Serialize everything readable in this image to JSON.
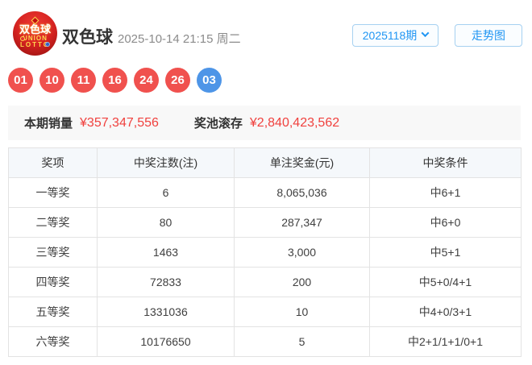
{
  "header": {
    "logo": {
      "line_cn": "双色球",
      "line_union": "UNION",
      "line_lotto": "LOTTO"
    },
    "title": "双色球",
    "datetime": "2025-10-14 21:15 周二",
    "period_selector": {
      "label": "2025118期"
    },
    "trend_button": "走势图"
  },
  "balls": {
    "red": [
      "01",
      "10",
      "11",
      "16",
      "24",
      "26"
    ],
    "blue": [
      "03"
    ]
  },
  "stats": {
    "sales_label": "本期销量",
    "sales_value": "¥357,347,556",
    "pool_label": "奖池滚存",
    "pool_value": "¥2,840,423,562"
  },
  "prize_table": {
    "headers": [
      "奖项",
      "中奖注数(注)",
      "单注奖金(元)",
      "中奖条件"
    ],
    "rows": [
      [
        "一等奖",
        "6",
        "8,065,036",
        "中6+1"
      ],
      [
        "二等奖",
        "80",
        "287,347",
        "中6+0"
      ],
      [
        "三等奖",
        "1463",
        "3,000",
        "中5+1"
      ],
      [
        "四等奖",
        "72833",
        "200",
        "中5+0/4+1"
      ],
      [
        "五等奖",
        "1331036",
        "10",
        "中4+0/3+1"
      ],
      [
        "六等奖",
        "10176650",
        "5",
        "中2+1/1+1/0+1"
      ]
    ]
  },
  "colors": {
    "red_ball": "#f0514e",
    "blue_ball": "#4e95e7",
    "accent_blue": "#2196f3",
    "value_red": "#f0413e"
  }
}
